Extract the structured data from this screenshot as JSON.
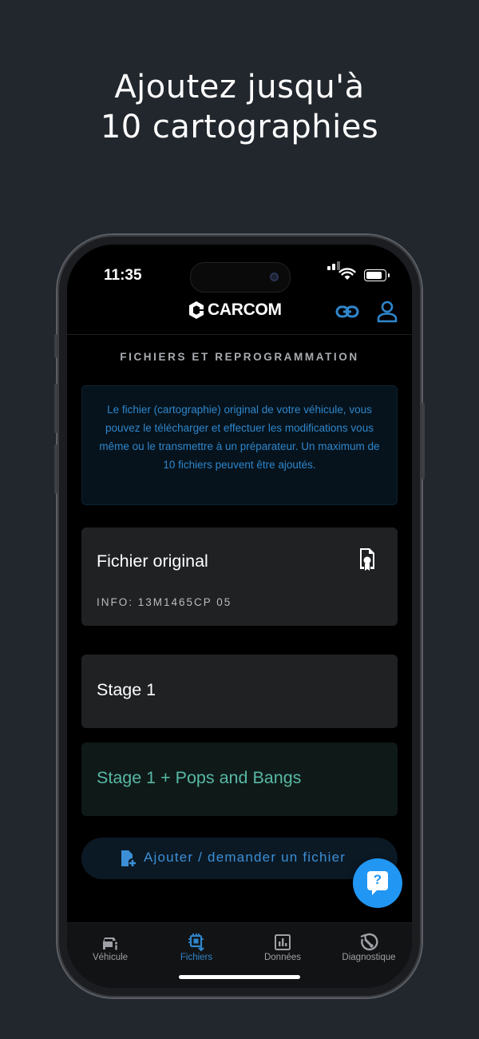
{
  "headline": {
    "line1": "Ajoutez jusqu'à",
    "line2": "10 cartographies"
  },
  "status_bar": {
    "time": "11:35",
    "icons": [
      "signal-icon",
      "wifi-icon",
      "battery-icon"
    ]
  },
  "header": {
    "brand": "CARCOM",
    "icons": [
      "carcom-logo-icon",
      "link-icon",
      "user-icon"
    ]
  },
  "section_title": "FICHIERS ET REPROGRAMMATION",
  "info_text": "Le fichier (cartographie) original de votre véhicule, vous pouvez le télécharger et effectuer les modifications vous même ou le transmettre à un préparateur. Un maximum de 10 fichiers peuvent être ajoutés.",
  "files": [
    {
      "title": "Fichier original",
      "info": "INFO: 13M1465CP 05",
      "icon": "file-certificate-icon"
    },
    {
      "title": "Stage 1"
    },
    {
      "title": "Stage 1 + Pops and Bangs"
    }
  ],
  "add_button": {
    "label": "Ajouter / demander un fichier",
    "icon": "file-plus-icon"
  },
  "fab": {
    "label": "?",
    "icon": "help-chat-icon"
  },
  "tabs": [
    {
      "label": "Véhicule",
      "icon": "car-info-icon",
      "active": false
    },
    {
      "label": "Fichiers",
      "icon": "chip-download-icon",
      "active": true
    },
    {
      "label": "Données",
      "icon": "bar-chart-icon",
      "active": false
    },
    {
      "label": "Diagnostique",
      "icon": "wrench-gauge-icon",
      "active": false
    }
  ],
  "colors": {
    "background": "#22272e",
    "accent_blue": "#2f86cc",
    "fab_blue": "#2196f3",
    "teal_text": "#58b8a6",
    "card_bg": "#202123"
  }
}
